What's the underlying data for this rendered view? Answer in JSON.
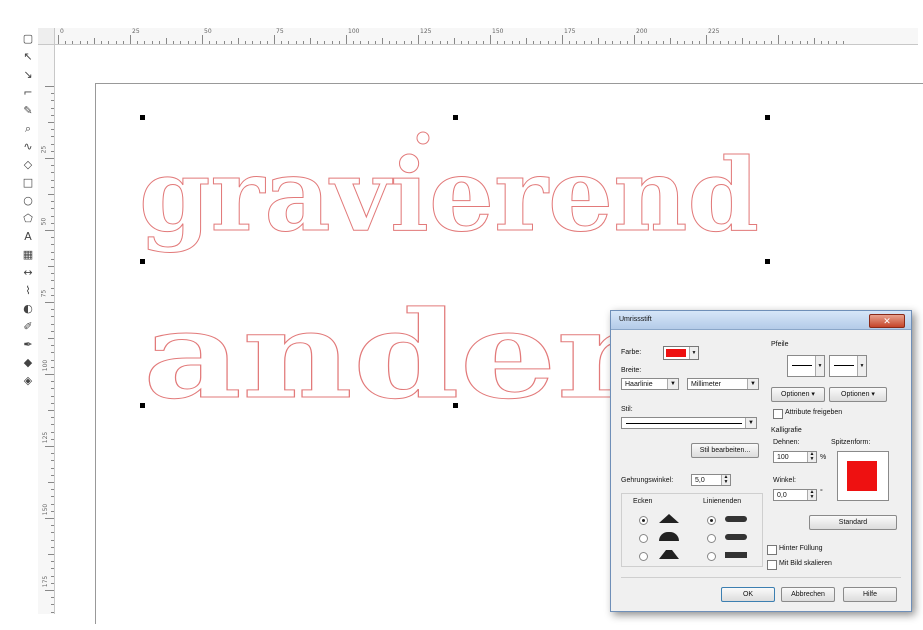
{
  "ruler": {
    "top_labels": [
      "0",
      "25",
      "50",
      "75",
      "100",
      "125",
      "150",
      "175",
      "200",
      "225"
    ],
    "left_labels": [
      "25",
      "50",
      "75",
      "100",
      "125",
      "150",
      "175",
      "200"
    ]
  },
  "canvas": {
    "line1": "gravierend",
    "line2": "anders",
    "outline_color": "#e27a7a"
  },
  "dialog": {
    "title": "Umrissstift",
    "close_glyph": "✕",
    "farbe_label": "Farbe:",
    "farbe_color": "#ee1111",
    "breite_label": "Breite:",
    "breite_value": "Haarlinie",
    "einheit_value": "Millimeter",
    "stil_label": "Stil:",
    "stil_bearbeiten": "Stil bearbeiten...",
    "gehrung_label": "Gehrungswinkel:",
    "gehrung_value": "5,0",
    "ecken_label": "Ecken",
    "linienenden_label": "Linienenden",
    "pfeile_label": "Pfeile",
    "optionen_left": "Optionen",
    "optionen_right": "Optionen",
    "attribute_label": "Attribute freigeben",
    "kalligrafie_label": "Kalligrafie",
    "dehnen_label": "Dehnen:",
    "dehnen_value": "100",
    "dehnen_unit": "%",
    "spitzenform_label": "Spitzenform:",
    "spitzen_color": "#ee1111",
    "winkel_label": "Winkel:",
    "winkel_value": "0,0",
    "winkel_unit": "°",
    "standard_label": "Standard",
    "hinter_fuellung": "Hinter Füllung",
    "mit_bild": "Mit Bild skalieren",
    "ok": "OK",
    "abbrechen": "Abbrechen",
    "hilfe": "Hilfe"
  }
}
